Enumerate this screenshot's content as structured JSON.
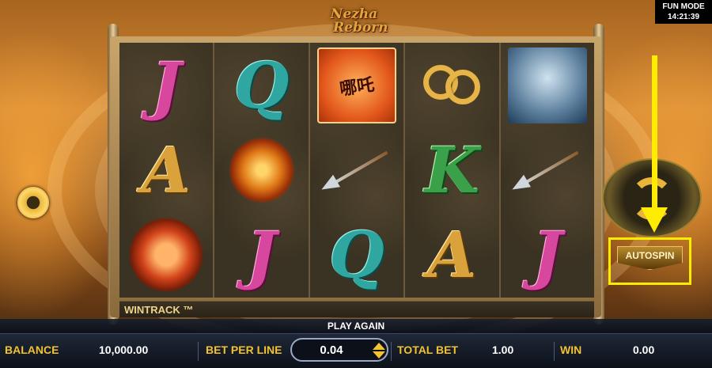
{
  "status": {
    "mode": "FUN MODE",
    "time": "14:21:39"
  },
  "logo": {
    "line1": "Nezha",
    "line2": "Reborn"
  },
  "reels": [
    [
      "J",
      "A",
      "flame-dragon-symbol"
    ],
    [
      "Q",
      "fire-wheel-symbol",
      "J"
    ],
    [
      "scroll-symbol",
      "spear-symbol",
      "Q"
    ],
    [
      "golden-rings-symbol",
      "K",
      "A"
    ],
    [
      "ice-dragon-symbol",
      "spear-symbol",
      "J"
    ]
  ],
  "wintrack": "WINTRACK ™",
  "controls": {
    "autospin_label": "AUTOSPIN",
    "play_again": "PLAY AGAIN"
  },
  "bottom_bar": {
    "balance_label": "BALANCE",
    "balance_value": "10,000.00",
    "bet_per_line_label": "BET PER LINE",
    "bet_per_line_value": "0.04",
    "total_bet_label": "TOTAL BET",
    "total_bet_value": "1.00",
    "win_label": "WIN",
    "win_value": "0.00"
  },
  "colors": {
    "highlight": "#ffec00",
    "label_gold": "#f2c230"
  }
}
